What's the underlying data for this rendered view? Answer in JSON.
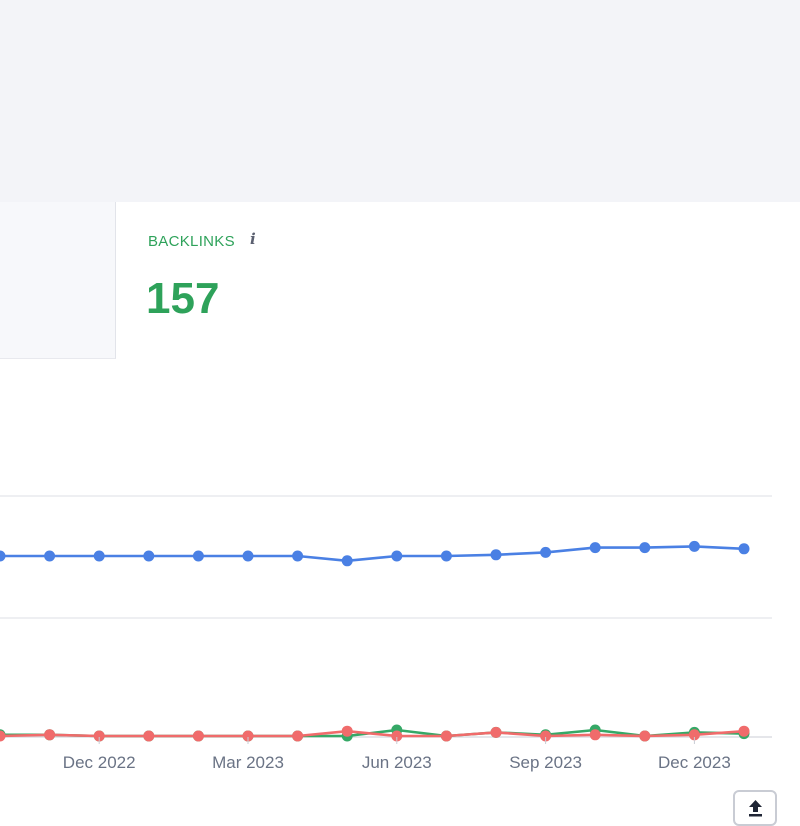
{
  "metric": {
    "label": "BACKLINKS",
    "info_glyph": "i",
    "value": "157"
  },
  "export_icon": "upload-icon",
  "colors": {
    "accent_green": "#2ea25a",
    "series_blue": "#4a80e4",
    "series_green": "#35a866",
    "series_red": "#f06b6b"
  },
  "chart_data": {
    "type": "line",
    "x": [
      "2022-10",
      "2022-11",
      "2022-12",
      "2023-01",
      "2023-02",
      "2023-03",
      "2023-04",
      "2023-05",
      "2023-06",
      "2023-07",
      "2023-08",
      "2023-09",
      "2023-10",
      "2023-11",
      "2023-12",
      "2024-01"
    ],
    "x_ticks": [
      "Dec 2022",
      "Mar 2023",
      "Jun 2023",
      "Sep 2023",
      "Dec 2023"
    ],
    "grid": true,
    "series": [
      {
        "color": "#4a80e4",
        "values": [
          150,
          150,
          150,
          150,
          150,
          150,
          150,
          146,
          150,
          150,
          151,
          153,
          157,
          157,
          158,
          156
        ]
      },
      {
        "color": "#35a866",
        "values": [
          1,
          1,
          0,
          0,
          0,
          0,
          0,
          0,
          5,
          0,
          3,
          1,
          5,
          0,
          3,
          2
        ]
      },
      {
        "color": "#f06b6b",
        "values": [
          0,
          1,
          0,
          0,
          0,
          0,
          0,
          4,
          0,
          0,
          3,
          0,
          1,
          0,
          1,
          4
        ]
      }
    ]
  }
}
